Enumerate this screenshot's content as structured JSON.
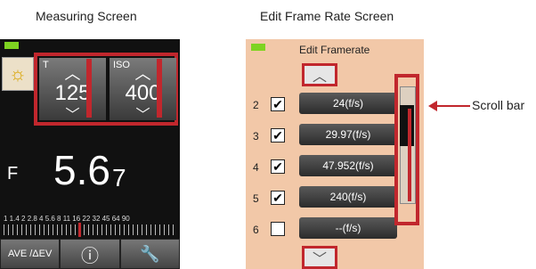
{
  "captions": {
    "left": "Measuring Screen",
    "right": "Edit Frame Rate Screen"
  },
  "measure": {
    "t_label": "T",
    "t_value": "125",
    "iso_label": "ISO",
    "iso_value": "400",
    "f_label": "F",
    "f_value": "5.6",
    "f_sub": "7",
    "scale": "1 1.4 2 2.8 4 5.6 8 11 16 22 32 45 64 90",
    "bottom": {
      "ave": "AVE /ΔEV"
    }
  },
  "edit": {
    "title": "Edit Framerate",
    "rows": [
      {
        "num": "2",
        "checked": true,
        "value": "24(f/s)"
      },
      {
        "num": "3",
        "checked": true,
        "value": "29.97(f/s)"
      },
      {
        "num": "4",
        "checked": true,
        "value": "47.952(f/s)"
      },
      {
        "num": "5",
        "checked": true,
        "value": "240(f/s)"
      },
      {
        "num": "6",
        "checked": false,
        "value": "--(f/s)"
      }
    ],
    "scrollbar_label": "Scroll bar"
  }
}
